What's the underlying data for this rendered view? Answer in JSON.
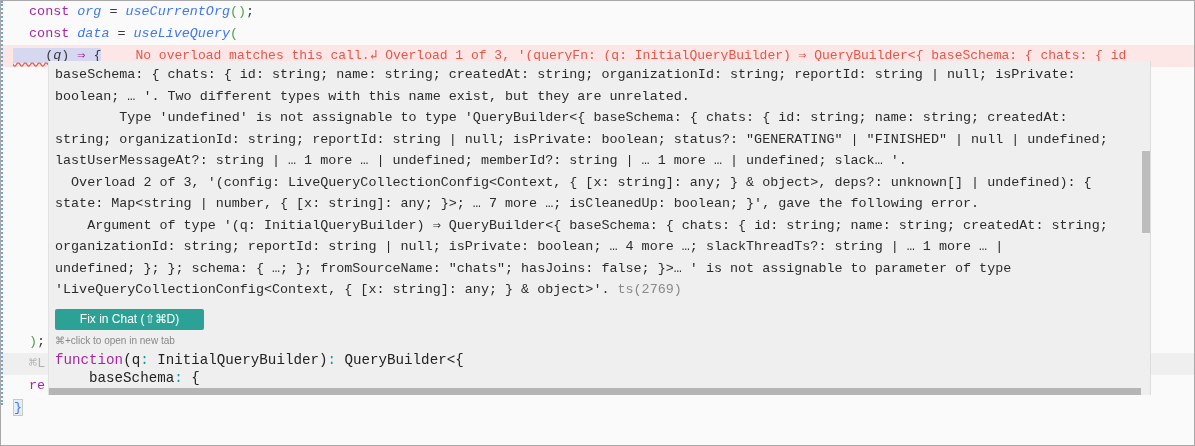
{
  "editor": {
    "lines": [
      {
        "kind": "normal",
        "tokens": [
          {
            "kind": "keyword",
            "text": "  const "
          },
          {
            "kind": "var",
            "text": "org"
          },
          {
            "kind": "plain",
            "text": " = "
          },
          {
            "kind": "fn",
            "text": "useCurrentOrg"
          },
          {
            "kind": "paren",
            "text": "()"
          },
          {
            "kind": "plain",
            "text": ";"
          }
        ]
      },
      {
        "kind": "normal",
        "tokens": [
          {
            "kind": "keyword",
            "text": "  const "
          },
          {
            "kind": "var",
            "text": "data"
          },
          {
            "kind": "plain",
            "text": " = "
          },
          {
            "kind": "fn",
            "text": "useLiveQuery"
          },
          {
            "kind": "paren",
            "text": "("
          }
        ]
      },
      {
        "kind": "error",
        "tokens": [
          {
            "kind": "plain",
            "text": "    ("
          },
          {
            "kind": "param",
            "text": "q"
          },
          {
            "kind": "plain",
            "text": ")"
          },
          {
            "kind": "keyword",
            "text": " ⇒ "
          },
          {
            "kind": "plain",
            "text": "{"
          }
        ],
        "diagnostic": "No overload matches this call.↲ Overload 1 of 3, '(queryFn: (q: InitialQueryBuilder) ⇒ QueryBuilder<{ baseSchema: { chats: { id"
      },
      {
        "kind": "gap"
      },
      {
        "kind": "normal",
        "tokens": [
          {
            "kind": "paren",
            "text": "  )"
          },
          {
            "kind": "plain",
            "text": ";"
          }
        ]
      },
      {
        "kind": "current",
        "tokens": [
          {
            "kind": "hint",
            "text": "  ⌘L"
          }
        ]
      },
      {
        "kind": "normal",
        "tokens": [
          {
            "kind": "keyword",
            "text": "  re"
          }
        ]
      },
      {
        "kind": "normal",
        "tokens": [
          {
            "kind": "bracket",
            "text": "}"
          }
        ]
      }
    ]
  },
  "hover": {
    "message_lines": [
      "baseSchema: { chats: { id: string; name: string; createdAt: string; organizationId: string; reportId: string | null; isPrivate:",
      "boolean; … '. Two different types with this name exist, but they are unrelated.",
      "        Type 'undefined' is not assignable to type 'QueryBuilder<{ baseSchema: { chats: { id: string; name: string; createdAt:",
      "string; organizationId: string; reportId: string | null; isPrivate: boolean; status?: \"GENERATING\" | \"FINISHED\" | null | undefined;",
      "lastUserMessageAt?: string | … 1 more … | undefined; memberId?: string | … 1 more … | undefined; slack… '.",
      "  Overload 2 of 3, '(config: LiveQueryCollectionConfig<Context, { [x: string]: any; } & object>, deps?: unknown[] | undefined): {",
      "state: Map<string | number, { [x: string]: any; }>; … 7 more …; isCleanedUp: boolean; }', gave the following error.",
      "    Argument of type '(q: InitialQueryBuilder) ⇒ QueryBuilder<{ baseSchema: { chats: { id: string; name: string; createdAt: string;",
      "organizationId: string; reportId: string | null; isPrivate: boolean; … 4 more …; slackThreadTs?: string | … 1 more … |",
      "undefined; }; }; schema: { …; }; fromSourceName: \"chats\"; hasJoins: false; }>… ' is not assignable to parameter of type",
      "'LiveQueryCollectionConfig<Context, { [x: string]: any; } & object>'."
    ],
    "error_code": "ts(2769)",
    "fix_button": "Fix in Chat (⇧⌘D)",
    "hint": "⌘+click to open in new tab",
    "preview": [
      [
        {
          "kind": "keyword",
          "text": "function"
        },
        {
          "kind": "plain",
          "text": "(q"
        },
        {
          "kind": "colon",
          "text": ": "
        },
        {
          "kind": "plain",
          "text": "InitialQueryBuilder)"
        },
        {
          "kind": "colon",
          "text": ": "
        },
        {
          "kind": "plain",
          "text": "QueryBuilder<{"
        }
      ],
      [
        {
          "kind": "plain",
          "text": "    baseSchema"
        },
        {
          "kind": "colon",
          "text": ": "
        },
        {
          "kind": "plain",
          "text": "{"
        }
      ]
    ]
  }
}
